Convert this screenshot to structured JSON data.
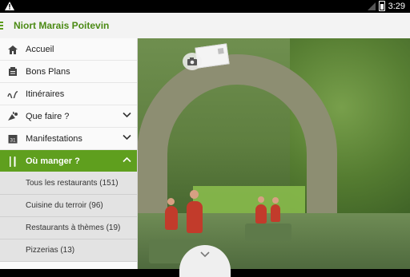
{
  "status_bar": {
    "time": "3:29",
    "warning_icon": "warning-icon"
  },
  "app_bar": {
    "title": "Niort Marais Poitevin",
    "menu_icon": "menu-icon"
  },
  "colors": {
    "accent": "#5f9f1e",
    "title_green": "#4b8a14"
  },
  "drawer": {
    "items": [
      {
        "label": "Accueil",
        "icon": "home-icon"
      },
      {
        "label": "Bons Plans",
        "icon": "coupon-icon"
      },
      {
        "label": "Itinéraires",
        "icon": "route-icon"
      },
      {
        "label": "Que faire ?",
        "icon": "activities-icon",
        "expandable": true
      },
      {
        "label": "Manifestations",
        "icon": "calendar-icon",
        "expandable": true
      },
      {
        "label": "Où manger ?",
        "icon": "cutlery-icon",
        "expandable": true,
        "expanded": true
      }
    ],
    "subitems": [
      {
        "label": "Tous les restaurants (151)"
      },
      {
        "label": "Cuisine du terroir (96)"
      },
      {
        "label": "Restaurants à thèmes (19)"
      },
      {
        "label": "Pizzerias (13)"
      }
    ]
  }
}
